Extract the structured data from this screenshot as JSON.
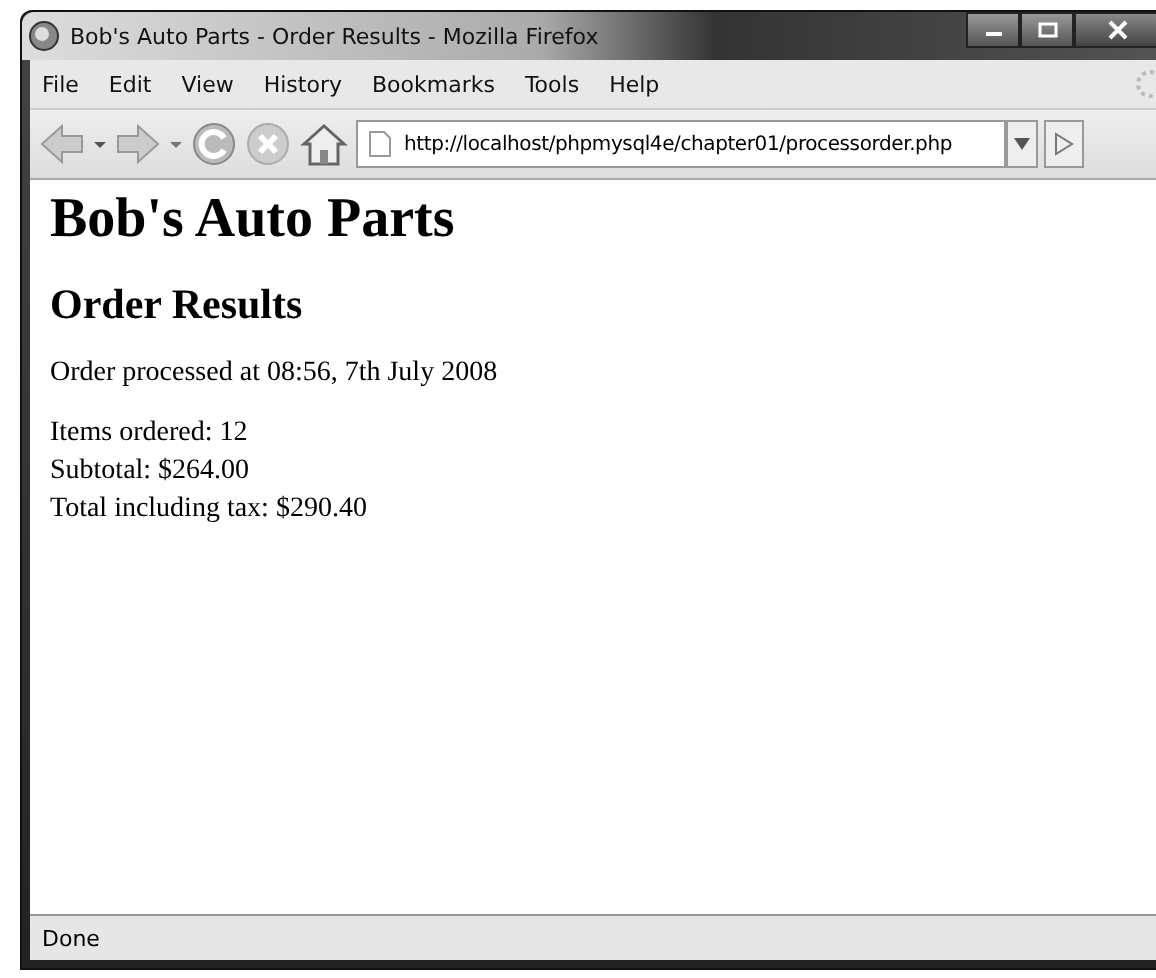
{
  "window": {
    "title": "Bob's Auto Parts - Order Results - Mozilla Firefox"
  },
  "menu_bar": [
    "File",
    "Edit",
    "View",
    "History",
    "Bookmarks",
    "Tools",
    "Help"
  ],
  "address_bar": {
    "value": "http://localhost/phpmysql4e/chapter01/processorder.php"
  },
  "page": {
    "heading": "Bob's Auto Parts",
    "subheading": "Order Results",
    "processed": "Order processed at 08:56, 7th July 2008",
    "lines": [
      "Items ordered: 12",
      "Subtotal: $264.00",
      "Total including tax: $290.40"
    ]
  },
  "status_bar": "Done"
}
